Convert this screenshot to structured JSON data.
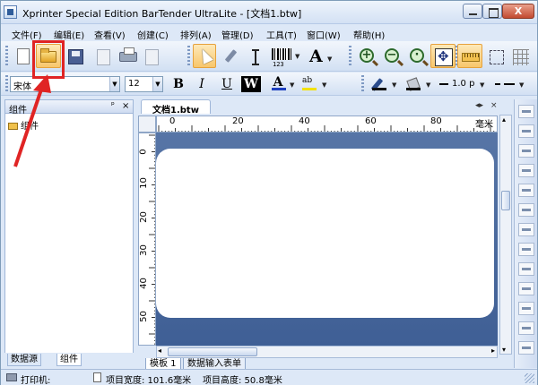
{
  "window": {
    "title": "Xprinter Special Edition BarTender UltraLite - [文档1.btw]",
    "controls": {
      "close_label": "X"
    }
  },
  "menu": [
    "文件(F)",
    "编辑(E)",
    "查看(V)",
    "创建(C)",
    "排列(A)",
    "管理(D)",
    "工具(T)",
    "窗口(W)",
    "帮助(H)"
  ],
  "toolbar": {
    "barcode_number": "123",
    "text_letter": "A"
  },
  "format_bar": {
    "font": "宋体",
    "size": "12",
    "bold": "B",
    "italic": "I",
    "underline": "U",
    "reverse": "W",
    "font_color": "A",
    "highlight": "ab",
    "font_color_hex": "#1d3fbf",
    "highlight_hex": "#f2e100",
    "line_width": "1.0 p"
  },
  "left_panel": {
    "title": "组件",
    "pin": "ᵖ",
    "close": "×",
    "tree_items": [
      "组件"
    ],
    "tabs": [
      "数据源",
      "组件"
    ]
  },
  "document": {
    "tab_title": "文档1.btw",
    "ruler_unit": "毫米",
    "ruler_top_labels": [
      "0",
      "20",
      "40",
      "60",
      "80"
    ],
    "ruler_left_labels": [
      "0",
      "10",
      "20",
      "30",
      "40",
      "50"
    ],
    "bottom_tabs": [
      "模板 1",
      "数据输入表单"
    ]
  },
  "status": {
    "printer": "打印机:",
    "item_width": "项目宽度: 101.6毫米",
    "item_height": "项目高度: 50.8毫米"
  },
  "colors": {
    "annotation": "#e02424",
    "canvas_bg": "#4a6aa0"
  }
}
